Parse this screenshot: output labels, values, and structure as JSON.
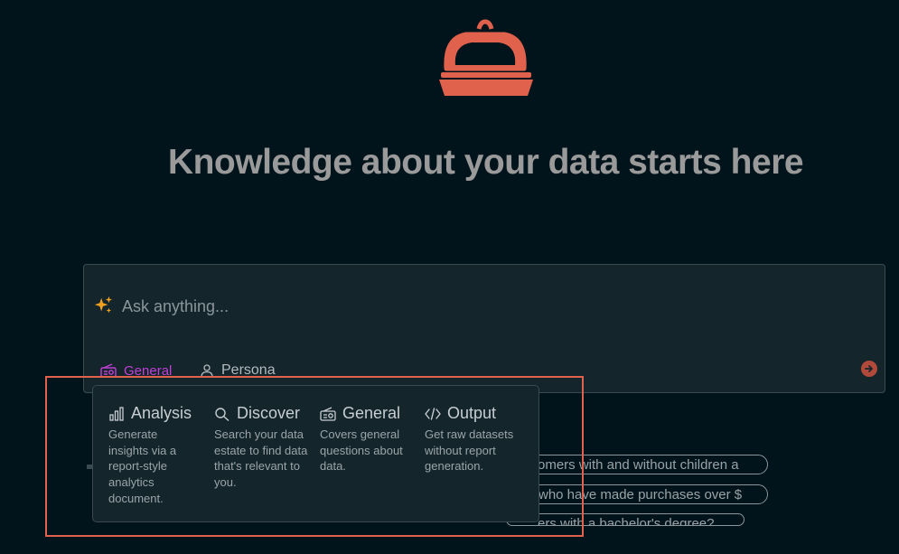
{
  "headline": "Knowledge about your data starts here",
  "chat": {
    "placeholder": "Ask anything...",
    "mode_label": "General",
    "persona_label": "Persona"
  },
  "suggestions": [
    "omers with and without children a",
    "who have made purchases over $",
    "ers with a bachelor's degree?"
  ],
  "mode_menu": [
    {
      "title": "Analysis",
      "icon": "bar-chart-icon",
      "description": "Generate insights via a report-style analytics document."
    },
    {
      "title": "Discover",
      "icon": "search-icon",
      "description": "Search your data estate to find data that's relevant to you."
    },
    {
      "title": "General",
      "icon": "radio-icon",
      "description": "Covers general questions about data."
    },
    {
      "title": "Output",
      "icon": "code-icon",
      "description": "Get raw datasets without report generation."
    }
  ],
  "colors": {
    "background": "#01141b",
    "panel": "#14252c",
    "logo": "#e0614c",
    "mode_accent": "#c03fd6",
    "sparkle": "#f0a020",
    "highlight": "#e0614c"
  }
}
